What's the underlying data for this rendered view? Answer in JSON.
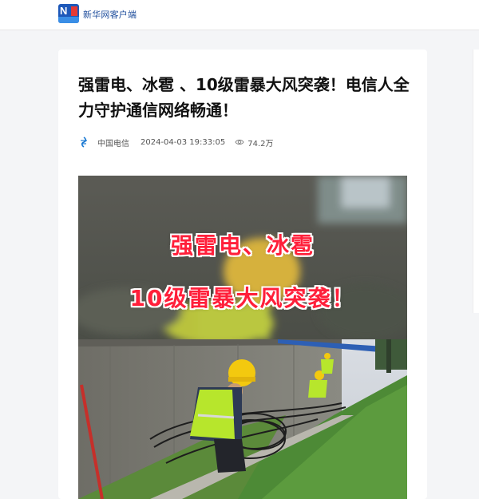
{
  "header": {
    "app_name": "新华网客户端",
    "logo_icon": "xinhua-app-logo-icon"
  },
  "article": {
    "title": "强雷电、冰雹 、10级雷暴大风突袭！电信人全力守护通信网络畅通！",
    "source": "中国电信",
    "source_icon": "china-telecom-logo-icon",
    "published": "2024-04-03 19:33:05",
    "views": "74.2万",
    "views_icon": "eye-icon"
  },
  "hero_image": {
    "overlay_line1": "强雷电、冰雹",
    "overlay_line2": "10级雷暴大风突袭！",
    "overlay_color": "#ff1f3a"
  },
  "colors": {
    "brand_blue": "#1d58b9",
    "page_background": "#f4f5f7"
  }
}
